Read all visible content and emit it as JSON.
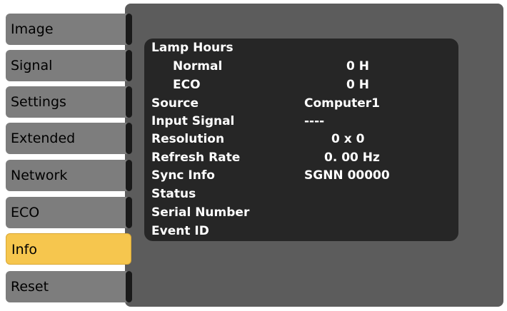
{
  "menu": {
    "items": [
      {
        "label": "Image"
      },
      {
        "label": "Signal"
      },
      {
        "label": "Settings"
      },
      {
        "label": "Extended"
      },
      {
        "label": "Network"
      },
      {
        "label": "ECO"
      },
      {
        "label": "Info"
      },
      {
        "label": "Reset"
      }
    ],
    "active": "Info"
  },
  "info": {
    "lamp_hours": {
      "label": "Lamp Hours"
    },
    "normal": {
      "label": "Normal",
      "value": "0 H"
    },
    "eco": {
      "label": "ECO",
      "value": "0 H"
    },
    "source": {
      "label": "Source",
      "value": "Computer1"
    },
    "input_signal": {
      "label": "Input Signal",
      "value": "----"
    },
    "resolution": {
      "label": "Resolution",
      "value": "0  x       0"
    },
    "refresh_rate": {
      "label": "Refresh Rate",
      "value": "0. 00 Hz"
    },
    "sync_info": {
      "label": "Sync Info",
      "value": "SGNN 00000"
    },
    "status": {
      "label": "Status"
    },
    "serial_number": {
      "label": "Serial Number"
    },
    "event_id": {
      "label": "Event ID"
    }
  },
  "colors": {
    "panel": "#5c5c5c",
    "list": "#262626",
    "menu_item": "#7d7d7d",
    "menu_active": "#f6c64e"
  }
}
